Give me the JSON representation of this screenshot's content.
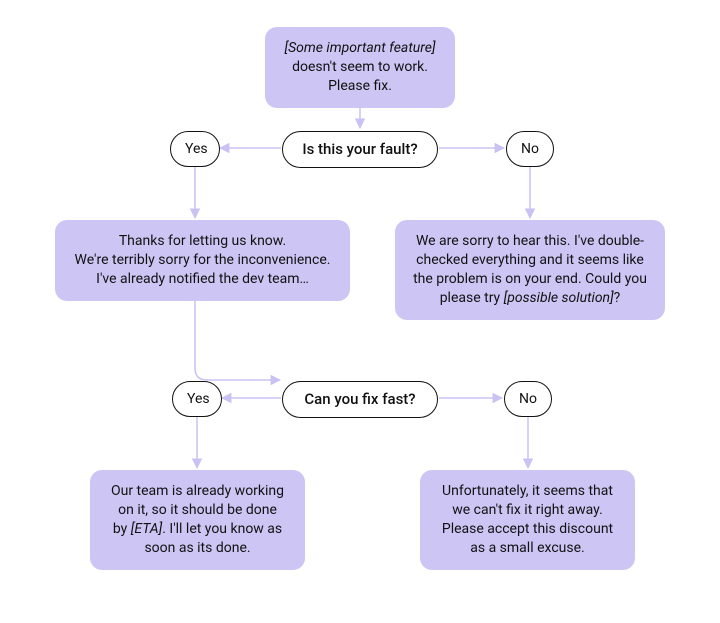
{
  "start": {
    "line1_em": "[Some important feature]",
    "line2": "doesn't seem to work.",
    "line3": "Please fix."
  },
  "decision1": {
    "question": "Is this your fault?",
    "yes": "Yes",
    "no": "No"
  },
  "yes1": {
    "line1": "Thanks for letting us know.",
    "line2": "We're terribly sorry for the inconvenience.",
    "line3": "I've already notified the dev team…"
  },
  "no1": {
    "line1": "We are sorry to hear this. I've double-",
    "line2": "checked everything and it seems like",
    "line3": "the problem is on your end. Could you",
    "line4_pre": "please try ",
    "line4_em": "[possible solution]",
    "line4_post": "?"
  },
  "decision2": {
    "question": "Can you fix fast?",
    "yes": "Yes",
    "no": "No"
  },
  "yes2": {
    "line1": "Our team is already working",
    "line2": "on it, so it should be done",
    "line3_pre": "by ",
    "line3_em": "[ETA]",
    "line3_post": ". I'll let you know as",
    "line4": "soon as its done."
  },
  "no2": {
    "line1": "Unfortunately, it seems that",
    "line2": "we can't fix it right away.",
    "line3": "Please accept this discount",
    "line4": "as a small excuse."
  }
}
